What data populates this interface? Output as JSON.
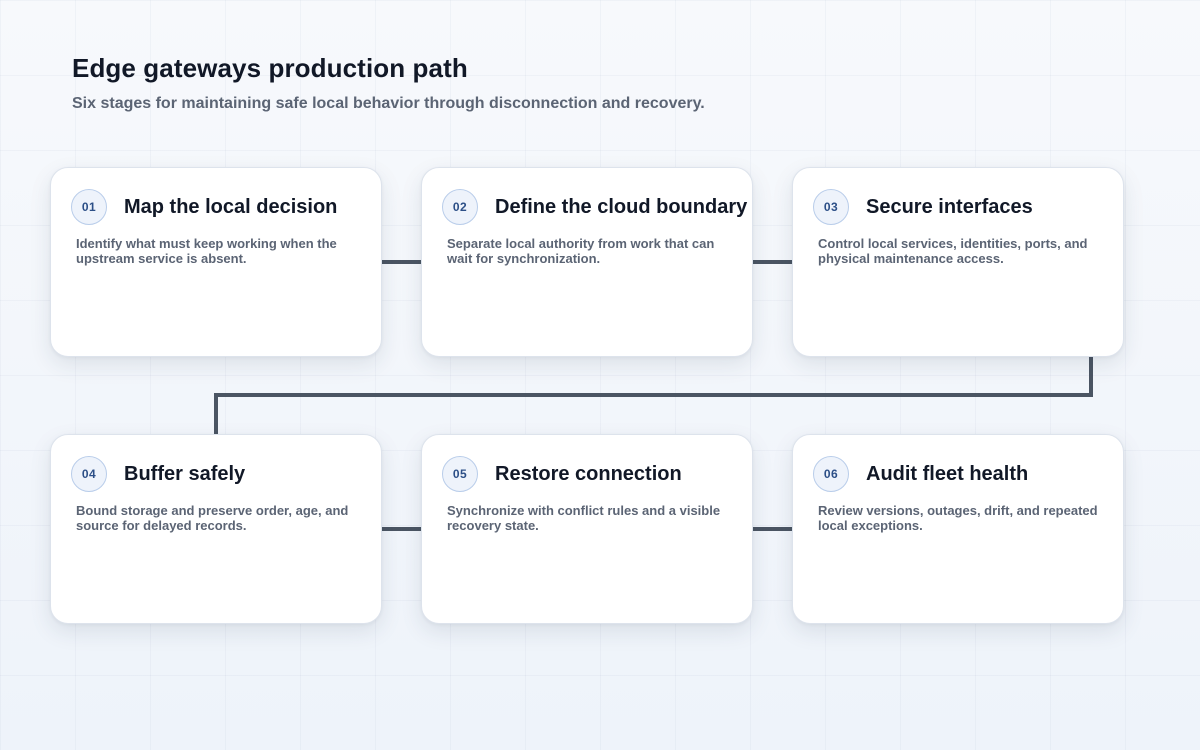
{
  "header": {
    "title": "Edge gateways production path",
    "subtitle": "Six stages for maintaining safe local behavior through disconnection and recovery."
  },
  "colors": {
    "connector": "#4b5563",
    "badge_border": "#b9cdea",
    "badge_text": "#2c4f87",
    "title_text": "#111827",
    "muted_text": "#5b6474",
    "card_background": "#ffffff",
    "page_background": "#f4f7fb"
  },
  "stages": [
    {
      "number": "01",
      "title": "Map the local decision",
      "description": "Identify what must keep working when the upstream service is absent."
    },
    {
      "number": "02",
      "title": "Define the cloud boundary",
      "description": "Separate local authority from work that can wait for synchronization."
    },
    {
      "number": "03",
      "title": "Secure interfaces",
      "description": "Control local services, identities, ports, and physical maintenance access."
    },
    {
      "number": "04",
      "title": "Buffer safely",
      "description": "Bound storage and preserve order, age, and source for delayed records."
    },
    {
      "number": "05",
      "title": "Restore connection",
      "description": "Synchronize with conflict rules and a visible recovery state."
    },
    {
      "number": "06",
      "title": "Audit fleet health",
      "description": "Review versions, outages, drift, and repeated local exceptions."
    }
  ]
}
